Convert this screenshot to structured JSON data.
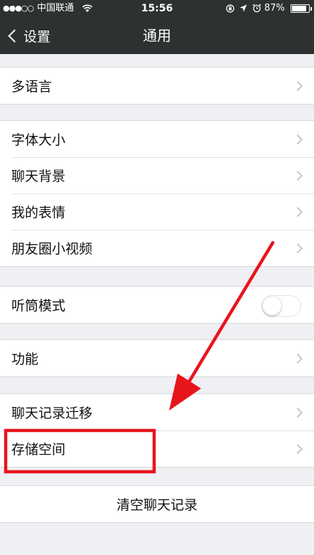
{
  "status_bar": {
    "signal": "●●●○○",
    "carrier": "中国联通",
    "time": "15:56",
    "battery_percent": "87%",
    "battery_level": 0.87
  },
  "nav": {
    "back_label": "设置",
    "title": "通用"
  },
  "groups": [
    {
      "items": [
        {
          "label": "多语言"
        }
      ]
    },
    {
      "items": [
        {
          "label": "字体大小"
        },
        {
          "label": "聊天背景"
        },
        {
          "label": "我的表情"
        },
        {
          "label": "朋友圈小视频"
        }
      ]
    },
    {
      "items": [
        {
          "label": "听筒模式",
          "toggle": false
        }
      ]
    },
    {
      "items": [
        {
          "label": "功能"
        }
      ]
    },
    {
      "items": [
        {
          "label": "聊天记录迁移"
        },
        {
          "label": "存储空间"
        }
      ]
    },
    {
      "items": [
        {
          "label": "清空聊天记录"
        }
      ]
    }
  ],
  "colors": {
    "nav_bg": "#2e3132",
    "page_bg": "#efeff4",
    "annotation_red": "#e8141c"
  }
}
